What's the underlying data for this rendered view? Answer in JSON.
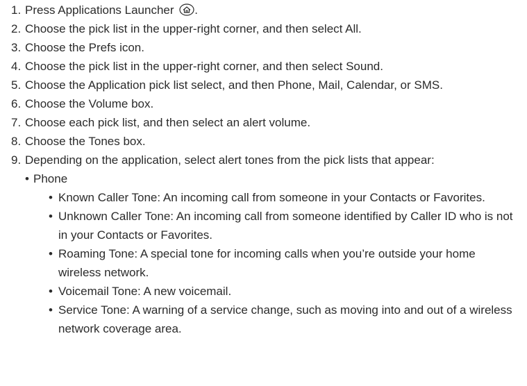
{
  "steps": [
    {
      "num": "1.",
      "text": "Press Applications Launcher",
      "icon": "home-icon",
      "suffix": "."
    },
    {
      "num": "2.",
      "text": "Choose the pick list in the upper-right corner, and then select All."
    },
    {
      "num": "3.",
      "text": "Choose the Prefs icon."
    },
    {
      "num": "4.",
      "text": "Choose the pick list in the upper-right corner, and then select Sound."
    },
    {
      "num": "5.",
      "text": "Choose the Application pick list select, and then Phone, Mail, Calendar, or SMS."
    },
    {
      "num": "6.",
      "text": "Choose the Volume box."
    },
    {
      "num": "7.",
      "text": "Choose each pick list, and then select an alert volume."
    },
    {
      "num": "8.",
      "text": "Choose the Tones box."
    },
    {
      "num": "9.",
      "text": "Depending on the application, select alert tones from the pick lists that appear:"
    }
  ],
  "bullet": "•",
  "phone": {
    "label": "Phone",
    "items": [
      {
        "term": "Known Caller Tone:",
        "desc": " An incoming call from someone in your Contacts or Favorites."
      },
      {
        "term": "Unknown Caller Tone:",
        "desc": " An incoming call from someone identified by Caller ID who is not in your Contacts or Favorites."
      },
      {
        "term": "Roaming Tone:",
        "desc": " A special tone for incoming calls when you’re outside your home wireless network."
      },
      {
        "term": "Voicemail Tone:",
        "desc": " A new voicemail."
      },
      {
        "term": "Service Tone:",
        "desc": " A warning of a service change, such as moving into and out of a wireless network coverage area."
      }
    ]
  }
}
